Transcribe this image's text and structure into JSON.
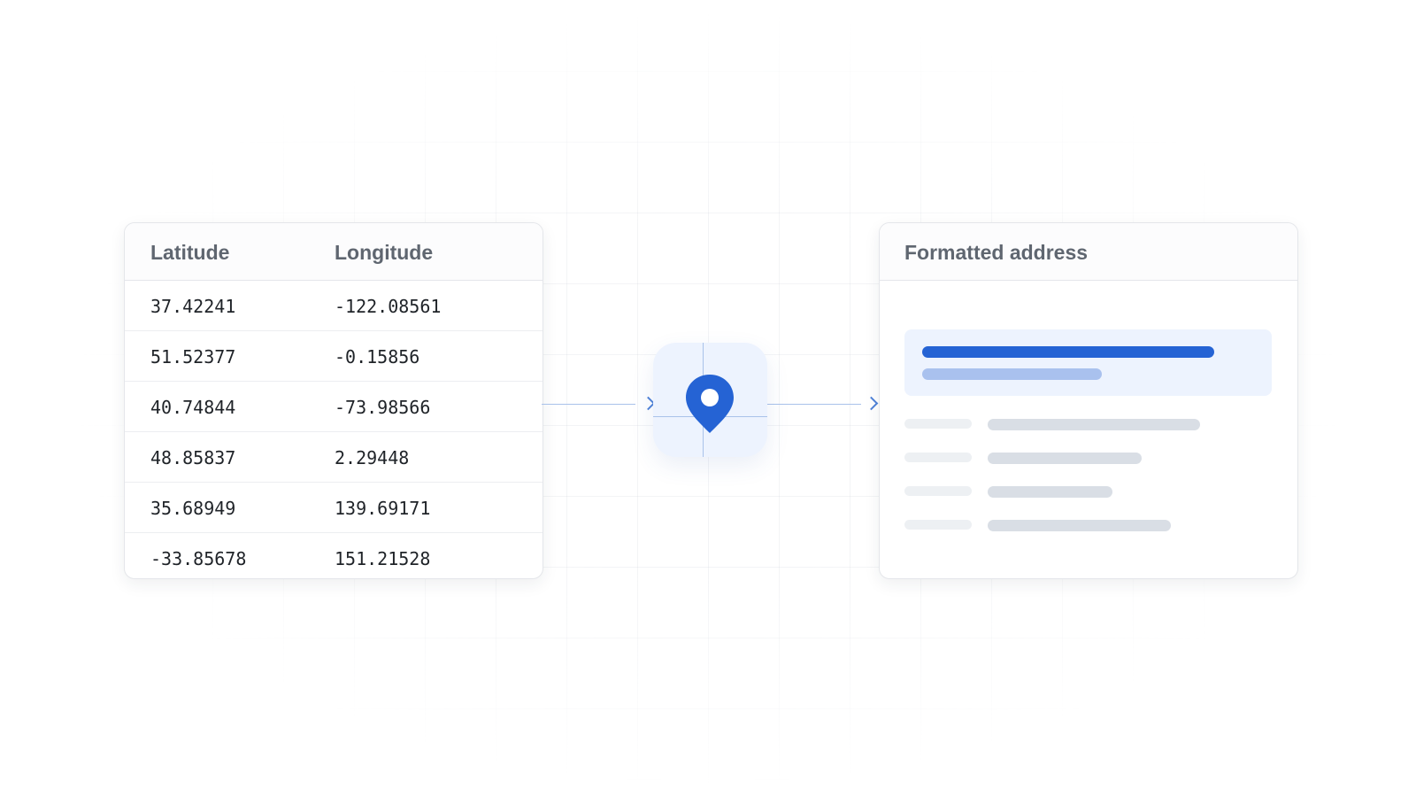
{
  "coordinates_table": {
    "columns": [
      "Latitude",
      "Longitude"
    ],
    "rows": [
      [
        "37.42241",
        "-122.08561"
      ],
      [
        "51.52377",
        "-0.15856"
      ],
      [
        "40.74844",
        "-73.98566"
      ],
      [
        "48.85837",
        "2.29448"
      ],
      [
        "35.68949",
        "139.69171"
      ],
      [
        "-33.85678",
        "151.21528"
      ]
    ]
  },
  "center": {
    "icon": "location-pin-icon"
  },
  "address_card": {
    "title": "Formatted address",
    "placeholder_line_count": 6
  },
  "colors": {
    "accent": "#2563d4",
    "accent_light": "#a9c1ee",
    "tile_bg": "#edf3fe",
    "heading_text": "#5f6670",
    "skeleton": "#d9dee5"
  }
}
